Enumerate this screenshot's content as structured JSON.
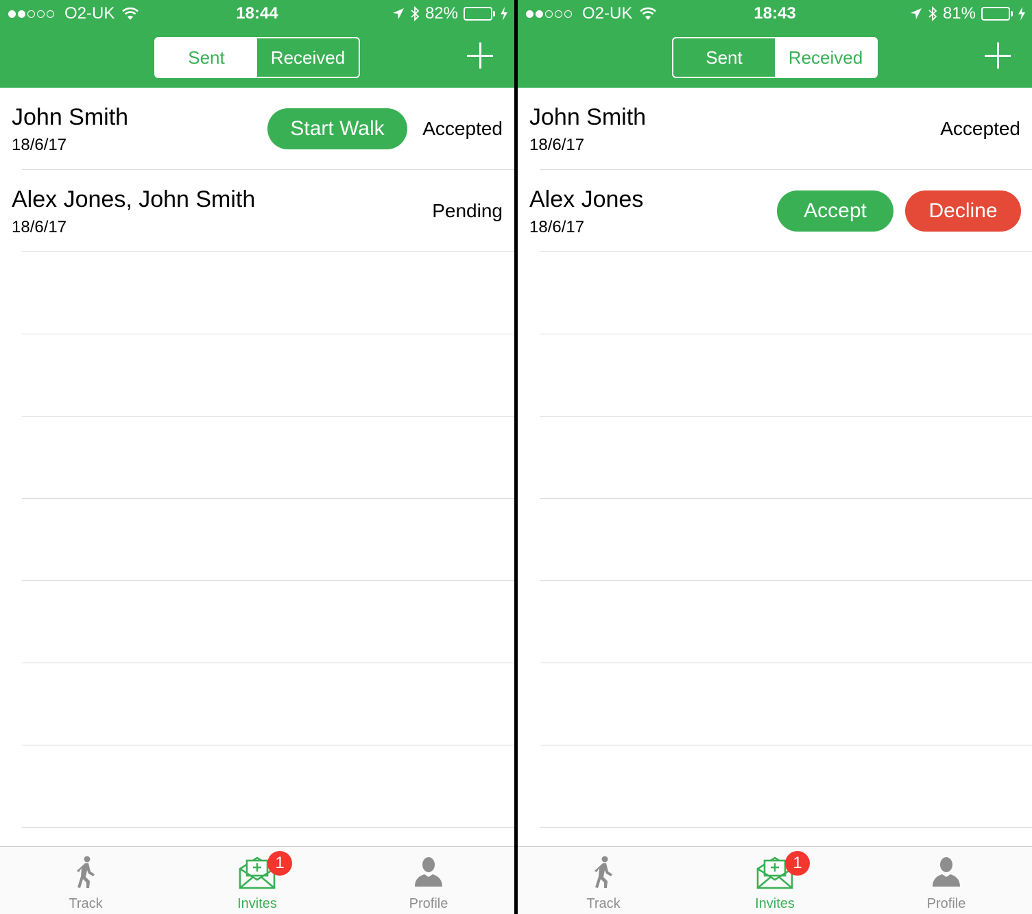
{
  "colors": {
    "brand_green": "#3ab055",
    "decline_red": "#e44a37",
    "badge_red": "#f5362e",
    "inactive_gray": "#8e8e8e"
  },
  "screens": [
    {
      "status_bar": {
        "carrier": "O2-UK",
        "time": "18:44",
        "battery_percent": "82%",
        "battery_level": 0.82
      },
      "segmented": {
        "sent": "Sent",
        "received": "Received",
        "selected": "sent"
      },
      "add_icon": "plus-icon",
      "rows": [
        {
          "names": "John Smith",
          "date": "18/6/17",
          "status": "Accepted",
          "action": "Start Walk"
        },
        {
          "names": "Alex Jones, John Smith",
          "date": "18/6/17",
          "status": "Pending"
        }
      ],
      "tabs": [
        {
          "label": "Track",
          "icon": "walking-person-icon"
        },
        {
          "label": "Invites",
          "icon": "envelope-invite-icon",
          "badge": "1"
        },
        {
          "label": "Profile",
          "icon": "person-icon"
        }
      ]
    },
    {
      "status_bar": {
        "carrier": "O2-UK",
        "time": "18:43",
        "battery_percent": "81%",
        "battery_level": 0.81
      },
      "segmented": {
        "sent": "Sent",
        "received": "Received",
        "selected": "received"
      },
      "add_icon": "plus-icon",
      "rows": [
        {
          "names": "John Smith",
          "date": "18/6/17",
          "status": "Accepted"
        },
        {
          "names": "Alex Jones",
          "date": "18/6/17",
          "accept": "Accept",
          "decline": "Decline"
        }
      ],
      "tabs": [
        {
          "label": "Track",
          "icon": "walking-person-icon"
        },
        {
          "label": "Invites",
          "icon": "envelope-invite-icon",
          "badge": "1"
        },
        {
          "label": "Profile",
          "icon": "person-icon"
        }
      ]
    }
  ]
}
